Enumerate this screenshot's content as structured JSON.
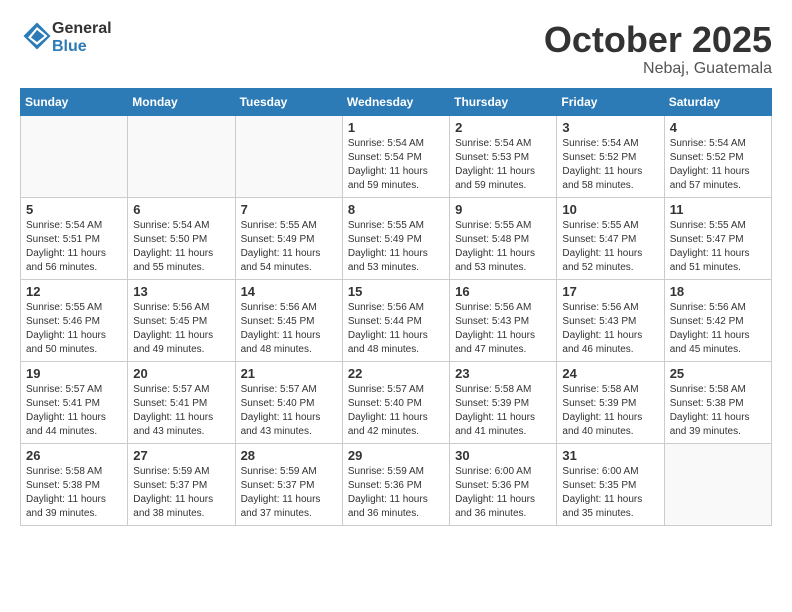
{
  "header": {
    "logo_general": "General",
    "logo_blue": "Blue",
    "month": "October 2025",
    "location": "Nebaj, Guatemala"
  },
  "days_of_week": [
    "Sunday",
    "Monday",
    "Tuesday",
    "Wednesday",
    "Thursday",
    "Friday",
    "Saturday"
  ],
  "weeks": [
    [
      {
        "day": "",
        "info": ""
      },
      {
        "day": "",
        "info": ""
      },
      {
        "day": "",
        "info": ""
      },
      {
        "day": "1",
        "info": "Sunrise: 5:54 AM\nSunset: 5:54 PM\nDaylight: 11 hours\nand 59 minutes."
      },
      {
        "day": "2",
        "info": "Sunrise: 5:54 AM\nSunset: 5:53 PM\nDaylight: 11 hours\nand 59 minutes."
      },
      {
        "day": "3",
        "info": "Sunrise: 5:54 AM\nSunset: 5:52 PM\nDaylight: 11 hours\nand 58 minutes."
      },
      {
        "day": "4",
        "info": "Sunrise: 5:54 AM\nSunset: 5:52 PM\nDaylight: 11 hours\nand 57 minutes."
      }
    ],
    [
      {
        "day": "5",
        "info": "Sunrise: 5:54 AM\nSunset: 5:51 PM\nDaylight: 11 hours\nand 56 minutes."
      },
      {
        "day": "6",
        "info": "Sunrise: 5:54 AM\nSunset: 5:50 PM\nDaylight: 11 hours\nand 55 minutes."
      },
      {
        "day": "7",
        "info": "Sunrise: 5:55 AM\nSunset: 5:49 PM\nDaylight: 11 hours\nand 54 minutes."
      },
      {
        "day": "8",
        "info": "Sunrise: 5:55 AM\nSunset: 5:49 PM\nDaylight: 11 hours\nand 53 minutes."
      },
      {
        "day": "9",
        "info": "Sunrise: 5:55 AM\nSunset: 5:48 PM\nDaylight: 11 hours\nand 53 minutes."
      },
      {
        "day": "10",
        "info": "Sunrise: 5:55 AM\nSunset: 5:47 PM\nDaylight: 11 hours\nand 52 minutes."
      },
      {
        "day": "11",
        "info": "Sunrise: 5:55 AM\nSunset: 5:47 PM\nDaylight: 11 hours\nand 51 minutes."
      }
    ],
    [
      {
        "day": "12",
        "info": "Sunrise: 5:55 AM\nSunset: 5:46 PM\nDaylight: 11 hours\nand 50 minutes."
      },
      {
        "day": "13",
        "info": "Sunrise: 5:56 AM\nSunset: 5:45 PM\nDaylight: 11 hours\nand 49 minutes."
      },
      {
        "day": "14",
        "info": "Sunrise: 5:56 AM\nSunset: 5:45 PM\nDaylight: 11 hours\nand 48 minutes."
      },
      {
        "day": "15",
        "info": "Sunrise: 5:56 AM\nSunset: 5:44 PM\nDaylight: 11 hours\nand 48 minutes."
      },
      {
        "day": "16",
        "info": "Sunrise: 5:56 AM\nSunset: 5:43 PM\nDaylight: 11 hours\nand 47 minutes."
      },
      {
        "day": "17",
        "info": "Sunrise: 5:56 AM\nSunset: 5:43 PM\nDaylight: 11 hours\nand 46 minutes."
      },
      {
        "day": "18",
        "info": "Sunrise: 5:56 AM\nSunset: 5:42 PM\nDaylight: 11 hours\nand 45 minutes."
      }
    ],
    [
      {
        "day": "19",
        "info": "Sunrise: 5:57 AM\nSunset: 5:41 PM\nDaylight: 11 hours\nand 44 minutes."
      },
      {
        "day": "20",
        "info": "Sunrise: 5:57 AM\nSunset: 5:41 PM\nDaylight: 11 hours\nand 43 minutes."
      },
      {
        "day": "21",
        "info": "Sunrise: 5:57 AM\nSunset: 5:40 PM\nDaylight: 11 hours\nand 43 minutes."
      },
      {
        "day": "22",
        "info": "Sunrise: 5:57 AM\nSunset: 5:40 PM\nDaylight: 11 hours\nand 42 minutes."
      },
      {
        "day": "23",
        "info": "Sunrise: 5:58 AM\nSunset: 5:39 PM\nDaylight: 11 hours\nand 41 minutes."
      },
      {
        "day": "24",
        "info": "Sunrise: 5:58 AM\nSunset: 5:39 PM\nDaylight: 11 hours\nand 40 minutes."
      },
      {
        "day": "25",
        "info": "Sunrise: 5:58 AM\nSunset: 5:38 PM\nDaylight: 11 hours\nand 39 minutes."
      }
    ],
    [
      {
        "day": "26",
        "info": "Sunrise: 5:58 AM\nSunset: 5:38 PM\nDaylight: 11 hours\nand 39 minutes."
      },
      {
        "day": "27",
        "info": "Sunrise: 5:59 AM\nSunset: 5:37 PM\nDaylight: 11 hours\nand 38 minutes."
      },
      {
        "day": "28",
        "info": "Sunrise: 5:59 AM\nSunset: 5:37 PM\nDaylight: 11 hours\nand 37 minutes."
      },
      {
        "day": "29",
        "info": "Sunrise: 5:59 AM\nSunset: 5:36 PM\nDaylight: 11 hours\nand 36 minutes."
      },
      {
        "day": "30",
        "info": "Sunrise: 6:00 AM\nSunset: 5:36 PM\nDaylight: 11 hours\nand 36 minutes."
      },
      {
        "day": "31",
        "info": "Sunrise: 6:00 AM\nSunset: 5:35 PM\nDaylight: 11 hours\nand 35 minutes."
      },
      {
        "day": "",
        "info": ""
      }
    ]
  ]
}
